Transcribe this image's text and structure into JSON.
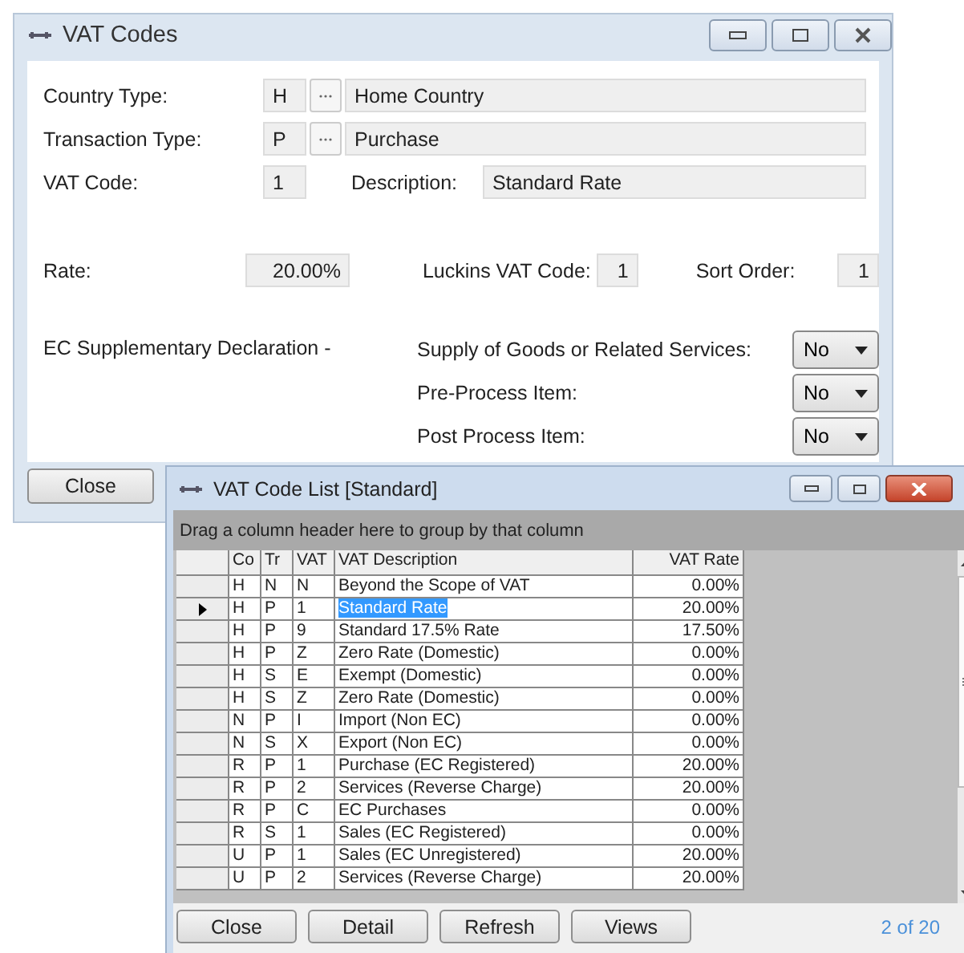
{
  "window": {
    "title": "VAT Codes"
  },
  "form": {
    "country_type": {
      "label": "Country Type:",
      "code": "H",
      "description": "Home Country"
    },
    "transaction_type": {
      "label": "Transaction Type:",
      "code": "P",
      "description": "Purchase"
    },
    "vat_code": {
      "label": "VAT Code:",
      "value": "1"
    },
    "description": {
      "label": "Description:",
      "value": "Standard Rate"
    },
    "rate": {
      "label": "Rate:",
      "value": "20.00%"
    },
    "luckins_vat_code": {
      "label": "Luckins VAT Code:",
      "value": "1"
    },
    "sort_order": {
      "label": "Sort Order:",
      "value": "1"
    },
    "ec_heading": "EC Supplementary Declaration -",
    "ec_items": [
      {
        "label": "Supply of Goods or Related Services:",
        "value": "No"
      },
      {
        "label": "Pre-Process Item:",
        "value": "No"
      },
      {
        "label": "Post Process Item:",
        "value": "No"
      }
    ]
  },
  "close_button": "Close",
  "list_window": {
    "title": "VAT Code List [Standard]",
    "group_hint": "Drag a column header here to group by that column",
    "table": {
      "columns": [
        "Co",
        "Tr",
        "VAT",
        "VAT Description",
        "VAT Rate"
      ],
      "rows": [
        {
          "cells": [
            "H",
            "N",
            "N",
            "Beyond the Scope of VAT",
            "0.00%"
          ],
          "selected": false
        },
        {
          "cells": [
            "H",
            "P",
            "1",
            "Standard Rate",
            "20.00%"
          ],
          "selected": true
        },
        {
          "cells": [
            "H",
            "P",
            "9",
            "Standard 17.5% Rate",
            "17.50%"
          ],
          "selected": false
        },
        {
          "cells": [
            "H",
            "P",
            "Z",
            "Zero Rate (Domestic)",
            "0.00%"
          ],
          "selected": false
        },
        {
          "cells": [
            "H",
            "S",
            "E",
            "Exempt (Domestic)",
            "0.00%"
          ],
          "selected": false
        },
        {
          "cells": [
            "H",
            "S",
            "Z",
            "Zero Rate (Domestic)",
            "0.00%"
          ],
          "selected": false
        },
        {
          "cells": [
            "N",
            "P",
            "I",
            "Import (Non EC)",
            "0.00%"
          ],
          "selected": false
        },
        {
          "cells": [
            "N",
            "S",
            "X",
            "Export (Non EC)",
            "0.00%"
          ],
          "selected": false
        },
        {
          "cells": [
            "R",
            "P",
            "1",
            "Purchase (EC Registered)",
            "20.00%"
          ],
          "selected": false
        },
        {
          "cells": [
            "R",
            "P",
            "2",
            "Services (Reverse Charge)",
            "20.00%"
          ],
          "selected": false
        },
        {
          "cells": [
            "R",
            "P",
            "C",
            "EC Purchases",
            "0.00%"
          ],
          "selected": false
        },
        {
          "cells": [
            "R",
            "S",
            "1",
            "Sales (EC Registered)",
            "0.00%"
          ],
          "selected": false
        },
        {
          "cells": [
            "U",
            "P",
            "1",
            "Sales (EC Unregistered)",
            "20.00%"
          ],
          "selected": false
        },
        {
          "cells": [
            "U",
            "P",
            "2",
            "Services (Reverse Charge)",
            "20.00%"
          ],
          "selected": false
        }
      ]
    },
    "buttons": [
      "Close",
      "Detail",
      "Refresh",
      "Views"
    ],
    "record_count": "2 of 20"
  }
}
